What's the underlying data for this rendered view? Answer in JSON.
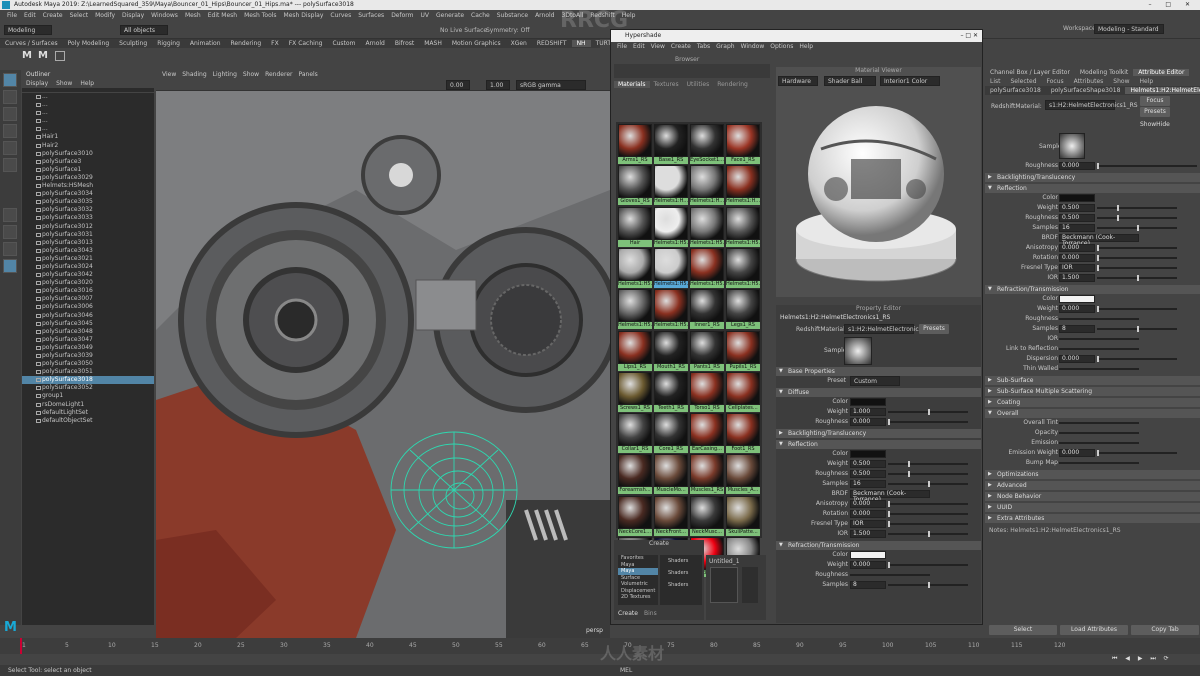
{
  "window": {
    "title": "Autodesk Maya 2019: Z:\\LearnedSquared_359\\Maya\\Bouncer_01_Hips\\Bouncer_01_Hips.ma* --- polySurface3018"
  },
  "menubar": [
    "File",
    "Edit",
    "Create",
    "Select",
    "Modify",
    "Display",
    "Windows",
    "Mesh",
    "Edit Mesh",
    "Mesh Tools",
    "Mesh Display",
    "Curves",
    "Surfaces",
    "Deform",
    "UV",
    "Generate",
    "Cache",
    "Substance",
    "Arnold",
    "3DtoAll",
    "Redshift",
    "Help"
  ],
  "status": {
    "mode": "Modeling",
    "objects": "All objects",
    "live": "No Live Surface",
    "symmetry": "Symmetry: Off",
    "workspace_label": "Workspace:",
    "workspace": "Modeling - Standard"
  },
  "shelf_tabs": [
    "Curves / Surfaces",
    "Poly Modeling",
    "Sculpting",
    "Rigging",
    "Animation",
    "Rendering",
    "FX",
    "FX Caching",
    "Custom",
    "Arnold",
    "Bifrost",
    "MASH",
    "Motion Graphics",
    "XGen",
    "REDSHIFT",
    "NH",
    "TURTLE"
  ],
  "shelf_active": "NH",
  "outliner": {
    "title": "Outliner",
    "menu": [
      "Display",
      "Show",
      "Help"
    ],
    "items": [
      "...",
      "...",
      "...",
      "...",
      "...",
      "Hair1",
      "Hair2",
      "polySurface3010",
      "polySurface3",
      "polySurface1",
      "polySurface3029",
      "Helmets:HSMesh",
      "polySurface3034",
      "polySurface3035",
      "polySurface3032",
      "polySurface3033",
      "polySurface3012",
      "polySurface3031",
      "polySurface3013",
      "polySurface3043",
      "polySurface3021",
      "polySurface3024",
      "polySurface3042",
      "polySurface3020",
      "polySurface3016",
      "polySurface3007",
      "polySurface3006",
      "polySurface3046",
      "polySurface3045",
      "polySurface3048",
      "polySurface3047",
      "polySurface3049",
      "polySurface3039",
      "polySurface3050",
      "polySurface3051",
      "polySurface3018",
      "polySurface3052",
      "group1",
      "rsDomeLight1",
      "defaultLightSet",
      "defaultObjectSet"
    ],
    "selected": "polySurface3018"
  },
  "viewport": {
    "menu": [
      "View",
      "Shading",
      "Lighting",
      "Show",
      "Renderer",
      "Panels"
    ],
    "cam_near": "0.00",
    "cam_far": "1.00",
    "colorspace": "sRGB gamma",
    "label": "persp"
  },
  "hypershade": {
    "title": "Hypershade",
    "menu": [
      "File",
      "Edit",
      "View",
      "Create",
      "Tabs",
      "Graph",
      "Window",
      "Options",
      "Help"
    ],
    "browser_label": "Browser",
    "browser_tabs": [
      "Materials",
      "Textures",
      "Utilities",
      "Rendering"
    ],
    "swatches": [
      "Arms1_RS",
      "Base1_RS",
      "EyeSocket1...",
      "Face1_RS",
      "Gloves1_RS",
      "Helmets1:H...",
      "Helmets1:H...",
      "Helmets1:H...",
      "Hair",
      "Helmets1:H5...",
      "Helmets1:H5...",
      "Helmets1:H5...",
      "Helmets1:H5...",
      "Helmets1:H5...",
      "Helmets1:H5...",
      "Helmets1:H5...",
      "Helmets1:H5...",
      "Helmets1:H5...",
      "Inner1_RS",
      "Legs1_RS",
      "Lips1_RS",
      "Mouth1_RS",
      "Pants1_RS",
      "Pupils1_RS",
      "Screws1_RS",
      "Teeth1_RS",
      "Torso1_RS",
      "Cellplates...",
      "Collar1_RS",
      "Core1_RS",
      "EarCasing...",
      "Foot1_RS",
      "Forearmsh...",
      "MuscleMo...",
      "Muscles1_RS",
      "Muscles_A...",
      "NeckCore1...",
      "NeckFront...",
      "NeckMusc...",
      "SkullPatte...",
      "lambert1",
      "particleClo...",
      "LED_R",
      "shaderGlow1"
    ],
    "selected_swatch": "Helmets1:H5...",
    "create_label": "Create",
    "create_tree": [
      "Favorites",
      "Maya",
      "Maya",
      "Surface",
      "Volumetric",
      "Displacement",
      "2D Textures"
    ],
    "create_items": [
      "Shaders",
      "Shaders",
      "Shaders"
    ],
    "untitled_tab": "Untitled_1",
    "create_btn": "Create",
    "bins_btn": "Bins",
    "material_viewer": {
      "title": "Material Viewer",
      "renderer": "Hardware",
      "geometry": "Shader Ball",
      "env": "Interior1 Color"
    },
    "property_editor": {
      "title": "Property Editor",
      "node": "Helmets1:H2:HelmetElectronics1_RS",
      "type_label": "RedshiftMaterial:",
      "type_value": "s1:H2:HelmetElectronics1_RS",
      "presets": "Presets",
      "sample_label": "Sample",
      "sections": {
        "base": "Base Properties",
        "diffuse": "Diffuse",
        "backlight": "Backlighting/Translucency",
        "reflection": "Reflection",
        "refraction": "Refraction/Transmission"
      },
      "preset": {
        "label": "Preset",
        "value": "Custom"
      },
      "diffuse": [
        {
          "label": "Color",
          "value": ""
        },
        {
          "label": "Weight",
          "value": "1.000"
        },
        {
          "label": "Roughness",
          "value": "0.000"
        }
      ],
      "reflection": [
        {
          "label": "Color",
          "value": ""
        },
        {
          "label": "Weight",
          "value": "0.500"
        },
        {
          "label": "Roughness",
          "value": "0.500"
        },
        {
          "label": "Samples",
          "value": "16"
        },
        {
          "label": "BRDF",
          "value": "Beckmann (Cook-Torrance)"
        },
        {
          "label": "Anisotropy",
          "value": "0.000"
        },
        {
          "label": "Rotation",
          "value": "0.000"
        },
        {
          "label": "Fresnel Type",
          "value": "IOR"
        },
        {
          "label": "IOR",
          "value": "1.500"
        }
      ],
      "refraction": [
        {
          "label": "Color",
          "value": ""
        },
        {
          "label": "Weight",
          "value": "0.000"
        },
        {
          "label": "Roughness",
          "value": ""
        },
        {
          "label": "Samples",
          "value": "8"
        }
      ]
    }
  },
  "attribute_editor": {
    "tabs": [
      "Channel Box / Layer Editor",
      "Modeling Toolkit",
      "Attribute Editor"
    ],
    "active_tab": "Attribute Editor",
    "menu": [
      "List",
      "Selected",
      "Focus",
      "Attributes",
      "Show",
      "Help"
    ],
    "node_tabs": [
      "polySurface3018",
      "polySurfaceShape3018",
      "Helmets1:H2:HelmetElectronics1_RS"
    ],
    "type_label": "RedshiftMaterial:",
    "type_value": "s1:H2:HelmetElectronics1_RS",
    "focus": "Focus",
    "presets": "Presets",
    "show": "Show",
    "hide": "Hide",
    "sample_label": "Sample",
    "roughness_top": {
      "label": "Roughness",
      "value": "0.000"
    },
    "sections": [
      "Backlighting/Translucency",
      "Reflection",
      "Refraction/Transmission",
      "Sub-Surface",
      "Sub-Surface Multiple Scattering",
      "Coating",
      "Overall",
      "Optimizations",
      "Advanced",
      "Node Behavior",
      "UUID",
      "Extra Attributes"
    ],
    "reflection": [
      {
        "label": "Color",
        "value": ""
      },
      {
        "label": "Weight",
        "value": "0.500"
      },
      {
        "label": "Roughness",
        "value": "0.500"
      },
      {
        "label": "Samples",
        "value": "16"
      },
      {
        "label": "BRDF",
        "value": "Beckmann (Cook-Torrance)"
      },
      {
        "label": "Anisotropy",
        "value": "0.000"
      },
      {
        "label": "Rotation",
        "value": "0.000"
      },
      {
        "label": "Fresnel Type",
        "value": "IOR"
      },
      {
        "label": "IOR",
        "value": "1.500"
      }
    ],
    "refraction": [
      {
        "label": "Color",
        "value": ""
      },
      {
        "label": "Weight",
        "value": "0.000"
      },
      {
        "label": "Roughness",
        "value": ""
      },
      {
        "label": "Samples",
        "value": "8"
      },
      {
        "label": "IOR",
        "value": ""
      },
      {
        "label": "Link to Reflection",
        "value": ""
      },
      {
        "label": "Dispersion",
        "value": "0.000"
      },
      {
        "label": "Thin Walled",
        "value": ""
      }
    ],
    "overall": [
      {
        "label": "Overall Tint",
        "value": ""
      },
      {
        "label": "Opacity",
        "value": ""
      },
      {
        "label": "Emission",
        "value": ""
      },
      {
        "label": "Emission Weight",
        "value": "0.000"
      },
      {
        "label": "Bump Map",
        "value": ""
      }
    ],
    "notes": "Notes: Helmets1:H2:HelmetElectronics1_RS",
    "buttons": [
      "Select",
      "Load Attributes",
      "Copy Tab"
    ]
  },
  "timeline": {
    "ticks": [
      "1",
      "5",
      "10",
      "15",
      "20",
      "25",
      "30",
      "35",
      "40",
      "45",
      "50",
      "55",
      "60",
      "65",
      "70",
      "75",
      "80",
      "85",
      "90",
      "95",
      "100",
      "105",
      "110",
      "115",
      "120"
    ],
    "current": "1"
  },
  "help_line": "Select Tool: select an object",
  "mel_label": "MEL",
  "watermark": "RRCG",
  "watermark_cn": "人人素材"
}
